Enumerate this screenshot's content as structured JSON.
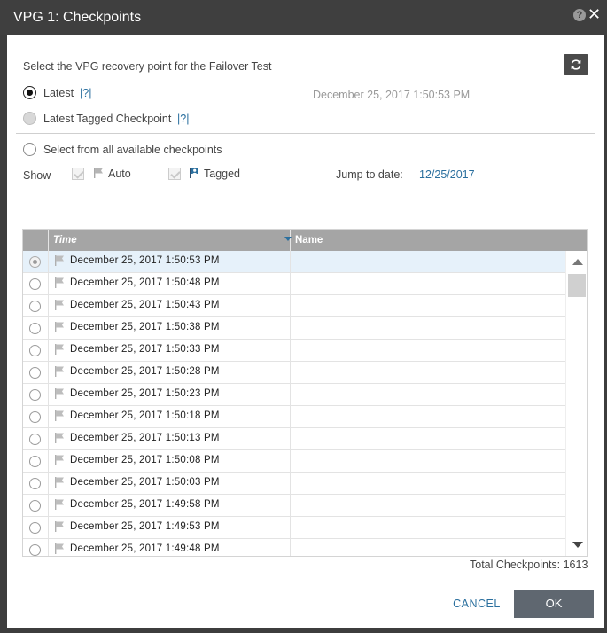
{
  "dialog": {
    "title": "VPG 1: Checkpoints",
    "help_glyph": "?",
    "close_glyph": "✕"
  },
  "recovery": {
    "instruction": "Select the VPG recovery point for the Failover Test",
    "latest_label": "Latest",
    "latest_help": "|?|",
    "latest_value": "December 25, 2017 1:50:53 PM",
    "latest_tagged_label": "Latest Tagged Checkpoint",
    "latest_tagged_help": "|?|",
    "select_all_label": "Select from all available checkpoints",
    "selected_option": "latest"
  },
  "filters": {
    "show_label": "Show",
    "auto_label": "Auto",
    "tagged_label": "Tagged",
    "jump_label": "Jump to date:",
    "jump_value": "12/25/2017"
  },
  "table": {
    "columns": [
      "Time",
      "Name"
    ],
    "rows": [
      {
        "time": "December 25, 2017 1:50:53 PM",
        "name": "",
        "selected": true
      },
      {
        "time": "December 25, 2017 1:50:48 PM",
        "name": ""
      },
      {
        "time": "December 25, 2017 1:50:43 PM",
        "name": ""
      },
      {
        "time": "December 25, 2017 1:50:38 PM",
        "name": ""
      },
      {
        "time": "December 25, 2017 1:50:33 PM",
        "name": ""
      },
      {
        "time": "December 25, 2017 1:50:28 PM",
        "name": ""
      },
      {
        "time": "December 25, 2017 1:50:23 PM",
        "name": ""
      },
      {
        "time": "December 25, 2017 1:50:18 PM",
        "name": ""
      },
      {
        "time": "December 25, 2017 1:50:13 PM",
        "name": ""
      },
      {
        "time": "December 25, 2017 1:50:08 PM",
        "name": ""
      },
      {
        "time": "December 25, 2017 1:50:03 PM",
        "name": ""
      },
      {
        "time": "December 25, 2017 1:49:58 PM",
        "name": ""
      },
      {
        "time": "December 25, 2017 1:49:53 PM",
        "name": ""
      },
      {
        "time": "December 25, 2017 1:49:48 PM",
        "name": ""
      }
    ]
  },
  "footer": {
    "total_label": "Total Checkpoints: 1613",
    "cancel_label": "CANCEL",
    "ok_label": "OK"
  },
  "colors": {
    "title_bar": "#3f3f3f",
    "accent_link": "#2a6f9e",
    "table_header": "#a5a5a5",
    "selected_row": "#e6f1fa",
    "ok_button": "#5f6770"
  },
  "icons": {
    "refresh": "refresh-icon",
    "flag": "flag-icon",
    "tagged_flag": "tagged-flag-icon",
    "sort": "sort-descending-icon"
  }
}
